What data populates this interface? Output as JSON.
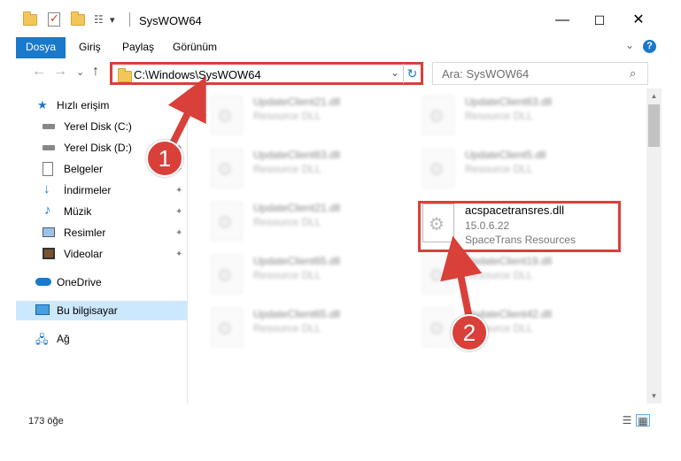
{
  "window": {
    "title": "SysWOW64",
    "minimize_glyph": "—",
    "maximize_glyph": "☐",
    "close_glyph": "✕"
  },
  "quick_access_toolbar": {
    "dropdown_glyph": "▾"
  },
  "ribbon": {
    "tabs": [
      {
        "label": "Dosya"
      },
      {
        "label": "Giriş"
      },
      {
        "label": "Paylaş"
      },
      {
        "label": "Görünüm"
      }
    ],
    "help_glyph": "?",
    "expand_glyph": "⌄"
  },
  "navigation": {
    "back_glyph": "←",
    "forward_glyph": "→",
    "recent_glyph": "⌄",
    "up_glyph": "↑",
    "address": "C:\\Windows\\SysWOW64",
    "address_dropdown_glyph": "⌄",
    "refresh_glyph": "↻",
    "search_placeholder": "Ara: SysWOW64",
    "search_glyph": "⌕"
  },
  "sidebar": {
    "items": [
      {
        "label": "Hızlı erişim",
        "icon": "star-icon",
        "pinned": false
      },
      {
        "label": "Yerel Disk (C:)",
        "icon": "drive-icon",
        "pinned": true
      },
      {
        "label": "Yerel Disk (D:)",
        "icon": "drive-icon",
        "pinned": true
      },
      {
        "label": "Belgeler",
        "icon": "documents-icon",
        "pinned": true
      },
      {
        "label": "İndirmeler",
        "icon": "download-icon",
        "pinned": true
      },
      {
        "label": "Müzik",
        "icon": "music-icon",
        "pinned": true
      },
      {
        "label": "Resimler",
        "icon": "pictures-icon",
        "pinned": true
      },
      {
        "label": "Videolar",
        "icon": "video-icon",
        "pinned": true
      },
      {
        "label": "OneDrive",
        "icon": "cloud-icon",
        "pinned": false
      },
      {
        "label": "Bu bilgisayar",
        "icon": "computer-icon",
        "pinned": false,
        "selected": true
      },
      {
        "label": "Ağ",
        "icon": "network-icon",
        "pinned": false
      }
    ],
    "pin_glyph": "📌"
  },
  "files": {
    "left_column": [
      {
        "name": "UpdateClient21.dll",
        "type": "Resource DLL"
      },
      {
        "name": "UpdateClient63.dll",
        "type": "Resource DLL"
      },
      {
        "name": "UpdateClient21.dll",
        "type": "Resource DLL"
      },
      {
        "name": "UpdateClient65.dll",
        "type": "Resource DLL"
      },
      {
        "name": "UpdateClient65.dll",
        "type": "Resource DLL"
      }
    ],
    "right_column": [
      {
        "name": "UpdateClient63.dll",
        "type": "Resource DLL"
      },
      {
        "name": "UpdateClient5.dll",
        "type": "Resource DLL"
      },
      {
        "name": "acspacetransres.dll",
        "version": "15.0.6.22",
        "type": "SpaceTrans Resources",
        "highlighted": true
      },
      {
        "name": "UpdateClient19.dll",
        "type": "Resource DLL"
      },
      {
        "name": "UpdateClient42.dll",
        "type": "Resource DLL"
      }
    ]
  },
  "status": {
    "item_count": "173 öğe"
  },
  "annotations": {
    "marker_1": "1",
    "marker_2": "2",
    "color": "#d9403a"
  },
  "colors": {
    "accent": "#1979ca",
    "selection": "#cce8ff",
    "annotation_red": "#d9403a"
  }
}
